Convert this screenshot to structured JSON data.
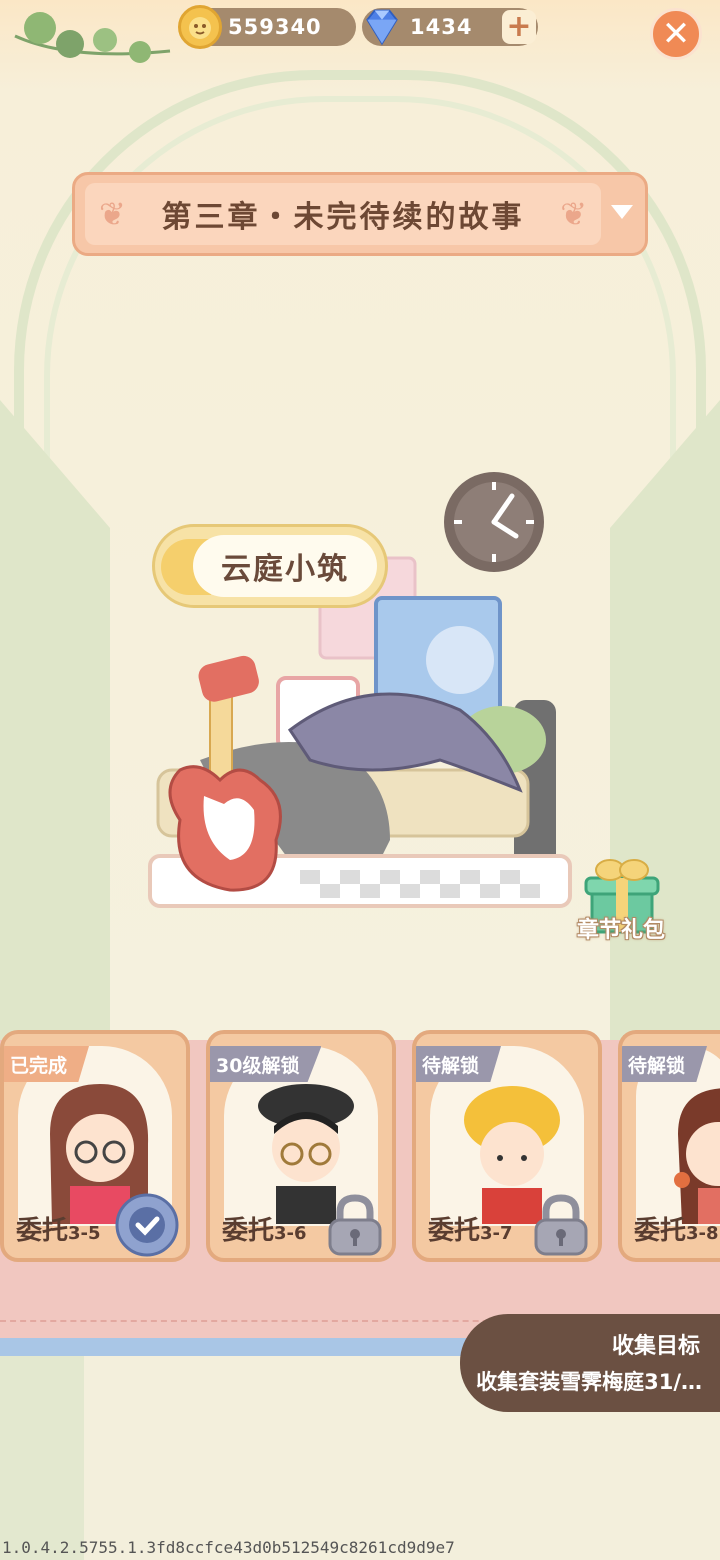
{
  "currency": {
    "coins": "559340",
    "gems": "1434",
    "add_label": "+"
  },
  "close_label": "✕",
  "chapter": {
    "title": "第三章・未完待续的故事"
  },
  "room": {
    "name": "云庭小筑"
  },
  "gift": {
    "label": "章节礼包"
  },
  "cards": [
    {
      "tag": "已完成",
      "name": "委托",
      "num": "3-5",
      "status": "done"
    },
    {
      "tag": "30级解锁",
      "name": "委托",
      "num": "3-6",
      "status": "locked"
    },
    {
      "tag": "待解锁",
      "name": "委托",
      "num": "3-7",
      "status": "locked"
    },
    {
      "tag": "待解锁",
      "name": "委托",
      "num": "3-8",
      "status": "locked"
    }
  ],
  "goal": {
    "title": "收集目标",
    "text": "收集套装雪霁梅庭31/…"
  },
  "version": "1.0.4.2.5755.1.3fd8ccfce43d0b512549c8261cd9d9e7",
  "colors": {
    "accent": "#f08a55",
    "card_bg": "#f4c9a2",
    "locked_tag": "#9a97ab",
    "done_tag": "#efae86"
  }
}
